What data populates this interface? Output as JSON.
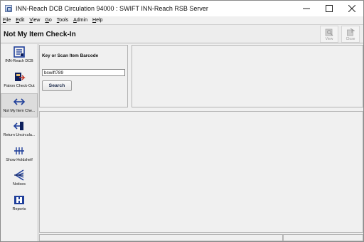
{
  "window": {
    "title": "INN-Reach DCB Circulation 94000 : SWIFT INN-Reach RSB Server"
  },
  "menu": [
    {
      "label": "File",
      "mnemonic": "F",
      "rest": "ile"
    },
    {
      "label": "Edit",
      "mnemonic": "E",
      "rest": "dit"
    },
    {
      "label": "View",
      "mnemonic": "V",
      "rest": "iew"
    },
    {
      "label": "Go",
      "mnemonic": "G",
      "rest": "o"
    },
    {
      "label": "Tools",
      "mnemonic": "T",
      "rest": "ools"
    },
    {
      "label": "Admin",
      "mnemonic": "A",
      "rest": "dmin"
    },
    {
      "label": "Help",
      "mnemonic": "H",
      "rest": "elp"
    }
  ],
  "header": {
    "title": "Not My Item Check-In",
    "view_label": "View",
    "close_label": "Close"
  },
  "sidebar": {
    "items": [
      {
        "label": "INN-Reach DCB",
        "icon": "dcb-icon"
      },
      {
        "label": "Patron Check-Out",
        "icon": "checkout-icon"
      },
      {
        "label": "Not My Item Che...",
        "icon": "not-my-item-checkin-icon",
        "active": true
      },
      {
        "label": "Return Uncircula...",
        "icon": "return-uncirculated-icon"
      },
      {
        "label": "Show Holdshelf",
        "icon": "holdshelf-icon"
      },
      {
        "label": "Notices",
        "icon": "notices-icon"
      },
      {
        "label": "Reports",
        "icon": "reports-icon"
      }
    ]
  },
  "search": {
    "label": "Key or Scan Item Barcode",
    "value": "bswift789",
    "button_label": "Search"
  },
  "colors": {
    "icon_blue": "#1f3f9a",
    "icon_dark": "#0d1f5c",
    "icon_red": "#c0392b"
  }
}
